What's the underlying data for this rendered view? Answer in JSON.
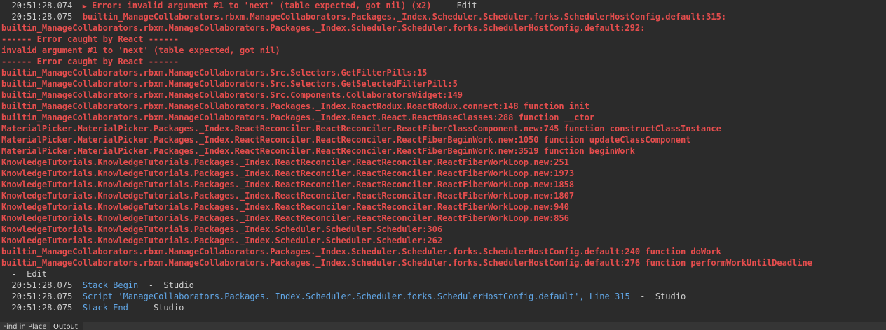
{
  "output": {
    "header_entry": {
      "timestamp": "20:51:28.074",
      "message": "Error: invalid argument #1 to 'next' (table expected, got nil) (x2)",
      "source": "  -  Edit"
    },
    "second_entry": {
      "timestamp": "20:51:28.075",
      "message": "builtin_ManageCollaborators.rbxm.ManageCollaborators.Packages._Index.Scheduler.Scheduler.forks.SchedulerHostConfig.default:315:"
    },
    "error_lines": [
      "builtin_ManageCollaborators.rbxm.ManageCollaborators.Packages._Index.Scheduler.Scheduler.forks.SchedulerHostConfig.default:292:",
      "------ Error caught by React ------",
      "invalid argument #1 to 'next' (table expected, got nil)",
      "------ Error caught by React ------",
      "builtin_ManageCollaborators.rbxm.ManageCollaborators.Src.Selectors.GetFilterPills:15",
      "builtin_ManageCollaborators.rbxm.ManageCollaborators.Src.Selectors.GetSelectedFilterPill:5",
      "builtin_ManageCollaborators.rbxm.ManageCollaborators.Src.Components.CollaboratorsWidget:149",
      "builtin_ManageCollaborators.rbxm.ManageCollaborators.Packages._Index.RoactRodux.RoactRodux.connect:148 function init",
      "builtin_ManageCollaborators.rbxm.ManageCollaborators.Packages._Index.React.React.ReactBaseClasses:288 function __ctor",
      "MaterialPicker.MaterialPicker.Packages._Index.ReactReconciler.ReactReconciler.ReactFiberClassComponent.new:745 function constructClassInstance",
      "MaterialPicker.MaterialPicker.Packages._Index.ReactReconciler.ReactReconciler.ReactFiberBeginWork.new:1050 function updateClassComponent",
      "MaterialPicker.MaterialPicker.Packages._Index.ReactReconciler.ReactReconciler.ReactFiberBeginWork.new:3519 function beginWork",
      "KnowledgeTutorials.KnowledgeTutorials.Packages._Index.ReactReconciler.ReactReconciler.ReactFiberWorkLoop.new:251",
      "KnowledgeTutorials.KnowledgeTutorials.Packages._Index.ReactReconciler.ReactReconciler.ReactFiberWorkLoop.new:1973",
      "KnowledgeTutorials.KnowledgeTutorials.Packages._Index.ReactReconciler.ReactReconciler.ReactFiberWorkLoop.new:1858",
      "KnowledgeTutorials.KnowledgeTutorials.Packages._Index.ReactReconciler.ReactReconciler.ReactFiberWorkLoop.new:1807",
      "KnowledgeTutorials.KnowledgeTutorials.Packages._Index.ReactReconciler.ReactReconciler.ReactFiberWorkLoop.new:940",
      "KnowledgeTutorials.KnowledgeTutorials.Packages._Index.ReactReconciler.ReactReconciler.ReactFiberWorkLoop.new:856",
      "KnowledgeTutorials.KnowledgeTutorials.Packages._Index.Scheduler.Scheduler.Scheduler:306",
      "KnowledgeTutorials.KnowledgeTutorials.Packages._Index.Scheduler.Scheduler.Scheduler:262",
      "builtin_ManageCollaborators.rbxm.ManageCollaborators.Packages._Index.Scheduler.Scheduler.forks.SchedulerHostConfig.default:240 function doWork",
      "builtin_ManageCollaborators.rbxm.ManageCollaborators.Packages._Index.Scheduler.Scheduler.forks.SchedulerHostConfig.default:276 function performWorkUntilDeadline"
    ],
    "edit_suffix": "  -  Edit",
    "stack_begin": {
      "timestamp": "20:51:28.075",
      "message": "Stack Begin",
      "source": "  -  Studio"
    },
    "script_line": {
      "timestamp": "20:51:28.075",
      "message": "Script 'ManageCollaborators.Packages._Index.Scheduler.Scheduler.forks.SchedulerHostConfig.default', Line 315",
      "source": "  -  Studio"
    },
    "stack_end": {
      "timestamp": "20:51:28.075",
      "message": "Stack End",
      "source": "  -  Studio"
    }
  },
  "tabs": {
    "find_in_place": "Find in Place",
    "output": "Output"
  },
  "colors": {
    "background": "#2b2b2b",
    "error": "#e54d4d",
    "info": "#62a8e8",
    "text": "#cccccc"
  }
}
